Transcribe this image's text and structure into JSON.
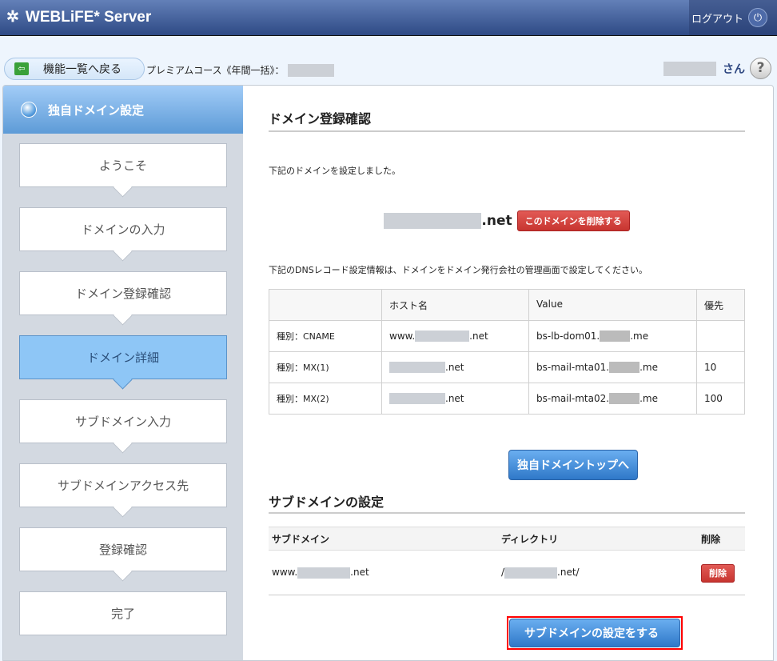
{
  "header": {
    "app_title": "WEBLiFE* Server",
    "logout_label": "ログアウト"
  },
  "topbar": {
    "back_label": "機能一覧へ戻る",
    "course_label": "プレミアムコース《年間一括》：",
    "user_suffix": "さん",
    "help_label": "?"
  },
  "sidebar": {
    "title": "独自ドメイン設定",
    "steps": [
      {
        "label": "ようこそ"
      },
      {
        "label": "ドメインの入力"
      },
      {
        "label": "ドメイン登録確認"
      },
      {
        "label": "ドメイン詳細",
        "active": true
      },
      {
        "label": "サブドメイン入力"
      },
      {
        "label": "サブドメインアクセス先"
      },
      {
        "label": "登録確認"
      },
      {
        "label": "完了"
      }
    ]
  },
  "main": {
    "title": "ドメイン登録確認",
    "message": "下記のドメインを設定しました。",
    "domain_suffix": ".net",
    "delete_domain_label": "このドメインを削除する",
    "dns_message": "下記のDNSレコード設定情報は、ドメインをドメイン発行会社の管理画面で設定してください。",
    "dns_table": {
      "headers": [
        "",
        "ホスト名",
        "Value",
        "優先"
      ],
      "rows": [
        {
          "type": "種別：CNAME",
          "host_prefix": "www.",
          "host_suffix": ".net",
          "value_prefix": "bs-lb-dom01.",
          "value_suffix": ".me",
          "priority": ""
        },
        {
          "type": "種別：MX(1)",
          "host_prefix": "",
          "host_suffix": ".net",
          "value_prefix": "bs-mail-mta01.",
          "value_suffix": ".me",
          "priority": "10"
        },
        {
          "type": "種別：MX(2)",
          "host_prefix": "",
          "host_suffix": ".net",
          "value_prefix": "bs-mail-mta02.",
          "value_suffix": ".me",
          "priority": "100"
        }
      ]
    },
    "top_button_label": "独自ドメイントップへ",
    "subdomain": {
      "title": "サブドメインの設定",
      "headers": [
        "サブドメイン",
        "ディレクトリ",
        "削除"
      ],
      "row": {
        "sub_prefix": "www.",
        "sub_suffix": ".net",
        "dir_prefix": "/",
        "dir_suffix": ".net/",
        "delete_label": "削除"
      }
    },
    "setup_button_label": "サブドメインの設定をする"
  },
  "colors": {
    "header": "#2e4a85",
    "active_step": "#8ec6f6",
    "danger": "#c73530",
    "primary": "#2f78c8",
    "highlight": "#ff0000"
  }
}
